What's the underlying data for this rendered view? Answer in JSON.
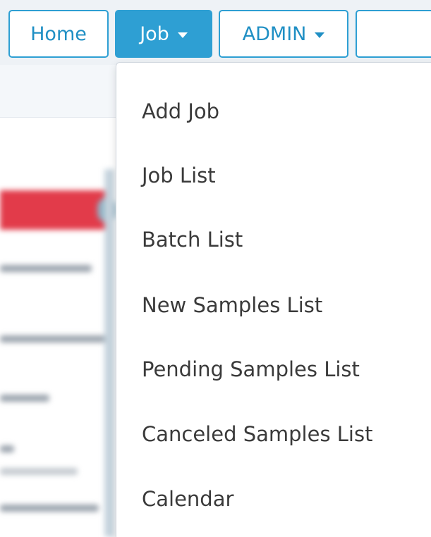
{
  "navbar": {
    "home_label": "Home",
    "job_label": "Job",
    "admin_label": "ADMIN",
    "search": {
      "value": "",
      "placeholder": ""
    }
  },
  "job_menu": {
    "items": [
      {
        "label": "Add Job"
      },
      {
        "label": "Job List"
      },
      {
        "label": "Batch List"
      },
      {
        "label": "New Samples List"
      },
      {
        "label": "Pending Samples List"
      },
      {
        "label": "Canceled Samples List"
      },
      {
        "label": "Calendar"
      }
    ]
  },
  "colors": {
    "accent": "#2e9fd3",
    "text": "#3a3a3a",
    "alert_red": "#e23b4a"
  }
}
